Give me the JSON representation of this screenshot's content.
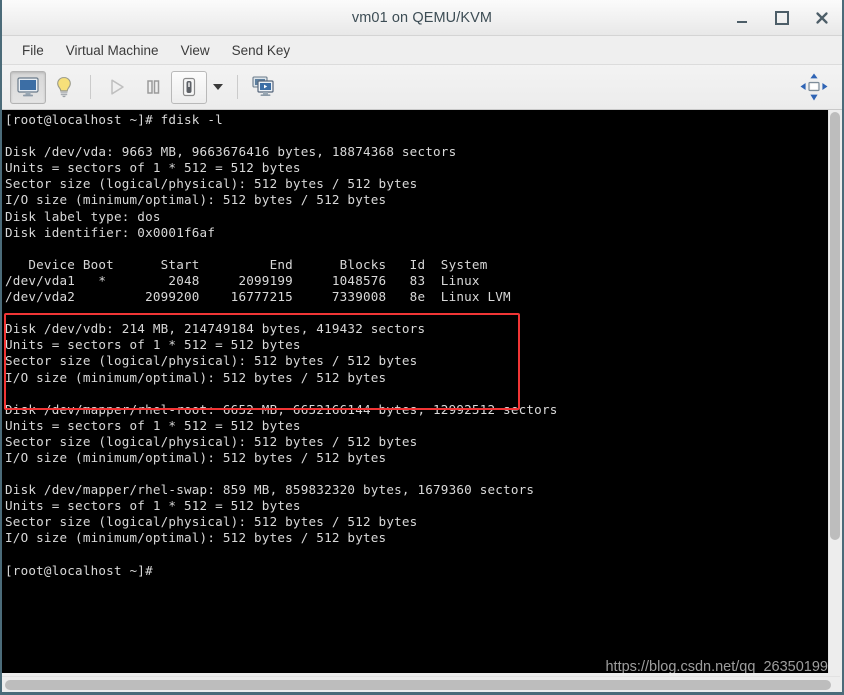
{
  "window": {
    "title": "vm01 on QEMU/KVM",
    "buttons": {
      "minimize": "minimize",
      "maximize": "maximize",
      "close": "close"
    }
  },
  "menubar": {
    "items": [
      {
        "label": "File"
      },
      {
        "label": "Virtual Machine"
      },
      {
        "label": "View"
      },
      {
        "label": "Send Key"
      }
    ]
  },
  "toolbar": {
    "items": [
      {
        "name": "show-console-button",
        "icon": "monitor-icon",
        "state": "pressed"
      },
      {
        "name": "show-details-button",
        "icon": "lightbulb-icon",
        "state": "normal"
      },
      {
        "name": "separator-1",
        "icon": "separator",
        "state": "static"
      },
      {
        "name": "run-button",
        "icon": "play-icon",
        "state": "disabled"
      },
      {
        "name": "pause-button",
        "icon": "pause-icon",
        "state": "normal"
      },
      {
        "name": "shutdown-button",
        "icon": "power-icon",
        "state": "framed"
      },
      {
        "name": "shutdown-menu-button",
        "icon": "chevron-down-icon",
        "state": "normal"
      },
      {
        "name": "separator-2",
        "icon": "separator",
        "state": "static"
      },
      {
        "name": "snapshots-button",
        "icon": "screens-icon",
        "state": "normal"
      }
    ],
    "right_button": {
      "name": "fit-to-vm-button",
      "icon": "resize-arrows-icon"
    }
  },
  "console": {
    "prompt_command": "[root@localhost ~]# fdisk -l",
    "text": "[root@localhost ~]# fdisk -l\n\nDisk /dev/vda: 9663 MB, 9663676416 bytes, 18874368 sectors\nUnits = sectors of 1 * 512 = 512 bytes\nSector size (logical/physical): 512 bytes / 512 bytes\nI/O size (minimum/optimal): 512 bytes / 512 bytes\nDisk label type: dos\nDisk identifier: 0x0001f6af\n\n   Device Boot      Start         End      Blocks   Id  System\n/dev/vda1   *        2048     2099199     1048576   83  Linux\n/dev/vda2         2099200    16777215     7339008   8e  Linux LVM\n\nDisk /dev/vdb: 214 MB, 214749184 bytes, 419432 sectors\nUnits = sectors of 1 * 512 = 512 bytes\nSector size (logical/physical): 512 bytes / 512 bytes\nI/O size (minimum/optimal): 512 bytes / 512 bytes\n\nDisk /dev/mapper/rhel-root: 6652 MB, 6652166144 bytes, 12992512 sectors\nUnits = sectors of 1 * 512 = 512 bytes\nSector size (logical/physical): 512 bytes / 512 bytes\nI/O size (minimum/optimal): 512 bytes / 512 bytes\n\nDisk /dev/mapper/rhel-swap: 859 MB, 859832320 bytes, 1679360 sectors\nUnits = sectors of 1 * 512 = 512 bytes\nSector size (logical/physical): 512 bytes / 512 bytes\nI/O size (minimum/optimal): 512 bytes / 512 bytes\n\n[root@localhost ~]#",
    "disks": [
      {
        "device": "/dev/vda",
        "size_mb": "9663 MB",
        "bytes": "9663676416 bytes",
        "sectors": "18874368 sectors",
        "units": "Units = sectors of 1 * 512 = 512 bytes",
        "sector_size": "Sector size (logical/physical): 512 bytes / 512 bytes",
        "io_size": "I/O size (minimum/optimal): 512 bytes / 512 bytes",
        "label_type": "Disk label type: dos",
        "identifier": "Disk identifier: 0x0001f6af",
        "highlighted": false
      },
      {
        "device": "/dev/vdb",
        "size_mb": "214 MB",
        "bytes": "214749184 bytes",
        "sectors": "419432 sectors",
        "units": "Units = sectors of 1 * 512 = 512 bytes",
        "sector_size": "Sector size (logical/physical): 512 bytes / 512 bytes",
        "io_size": "I/O size (minimum/optimal): 512 bytes / 512 bytes",
        "highlighted": true
      },
      {
        "device": "/dev/mapper/rhel-root",
        "size_mb": "6652 MB",
        "bytes": "6652166144 bytes",
        "sectors": "12992512 sectors",
        "units": "Units = sectors of 1 * 512 = 512 bytes",
        "sector_size": "Sector size (logical/physical): 512 bytes / 512 bytes",
        "io_size": "I/O size (minimum/optimal): 512 bytes / 512 bytes",
        "highlighted": false
      },
      {
        "device": "/dev/mapper/rhel-swap",
        "size_mb": "859 MB",
        "bytes": "859832320 bytes",
        "sectors": "1679360 sectors",
        "units": "Units = sectors of 1 * 512 = 512 bytes",
        "sector_size": "Sector size (logical/physical): 512 bytes / 512 bytes",
        "io_size": "I/O size (minimum/optimal): 512 bytes / 512 bytes",
        "highlighted": false
      }
    ],
    "partition_table": {
      "headers": [
        "Device",
        "Boot",
        "Start",
        "End",
        "Blocks",
        "Id",
        "System"
      ],
      "rows": [
        [
          "/dev/vda1",
          "*",
          "2048",
          "2099199",
          "1048576",
          "83",
          "Linux"
        ],
        [
          "/dev/vda2",
          "",
          "2099200",
          "16777215",
          "7339008",
          "8e",
          "Linux LVM"
        ]
      ]
    },
    "final_prompt": "[root@localhost ~]#",
    "highlight_color": "#f03535"
  },
  "watermark": {
    "text": "https://blog.csdn.net/qq_26350199"
  }
}
